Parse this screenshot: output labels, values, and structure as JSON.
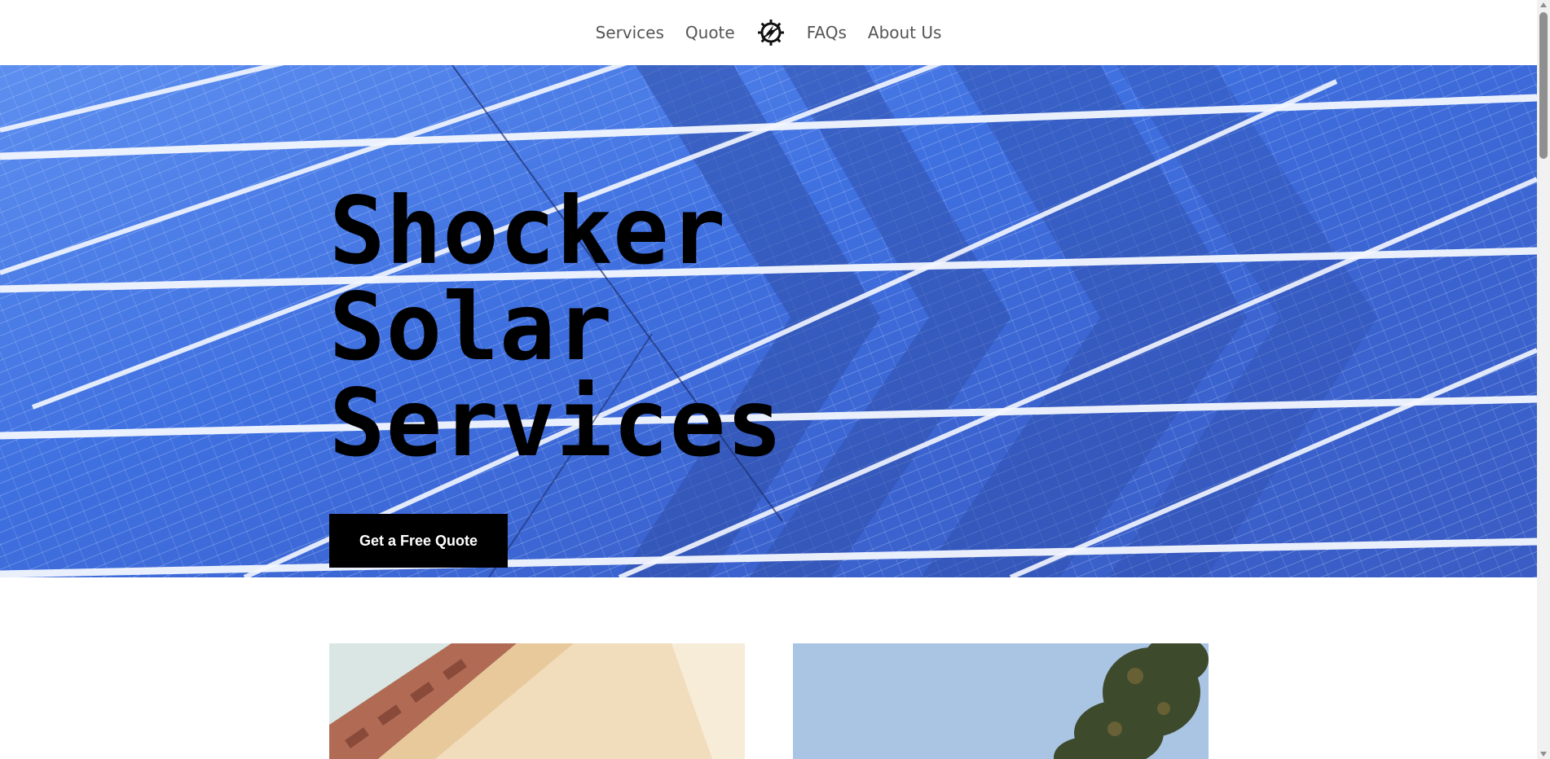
{
  "nav": {
    "items_left": [
      "Services",
      "Quote"
    ],
    "items_right": [
      "FAQs",
      "About Us"
    ],
    "logo_icon": "lightning-gear-icon"
  },
  "hero": {
    "title_line1": "Shocker Solar",
    "title_line2": "Services",
    "cta_label": "Get a Free Quote",
    "background_image": "solar-panel-array"
  },
  "cards": [
    {
      "image": "house-roof-tiles"
    },
    {
      "image": "sky-tree"
    }
  ],
  "colors": {
    "accent": "#000000",
    "hero_blue": "#3f70e0",
    "nav_text": "#555555"
  }
}
